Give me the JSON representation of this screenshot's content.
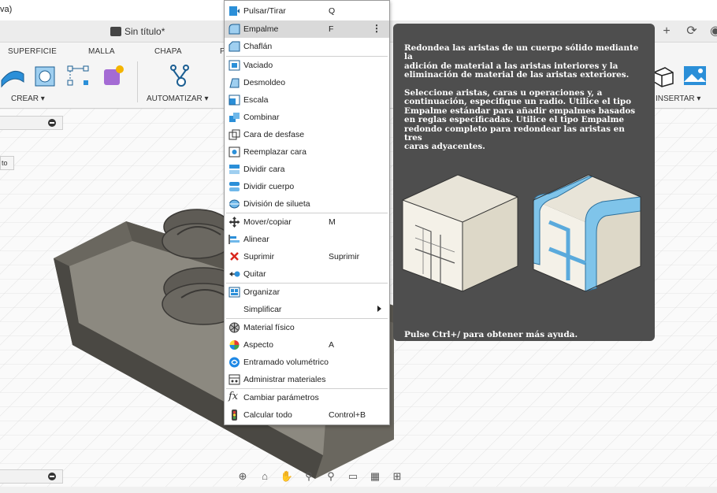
{
  "window": {
    "title": "va)"
  },
  "document": {
    "title": "Sin título*"
  },
  "ribbon": {
    "tabs": [
      "SUPERFICIE",
      "MALLA",
      "CHAPA",
      "P"
    ],
    "groups": {
      "create": "CREAR ▾",
      "automate": "AUTOMATIZAR ▾",
      "insert": "INSERTAR ▾"
    }
  },
  "browser": {
    "partial_label": "to"
  },
  "menu": {
    "items": [
      {
        "label": "Pulsar/Tirar",
        "shortcut": "Q",
        "icon": "push-pull-icon"
      },
      {
        "label": "Empalme",
        "shortcut": "F",
        "icon": "fillet-icon",
        "active": true
      },
      {
        "label": "Chaflán",
        "shortcut": "",
        "icon": "chamfer-icon"
      },
      {
        "label": "Vaciado",
        "shortcut": "",
        "icon": "shell-icon"
      },
      {
        "label": "Desmoldeo",
        "shortcut": "",
        "icon": "draft-icon"
      },
      {
        "label": "Escala",
        "shortcut": "",
        "icon": "scale-icon"
      },
      {
        "label": "Combinar",
        "shortcut": "",
        "icon": "combine-icon"
      },
      {
        "label": "Cara de desfase",
        "shortcut": "",
        "icon": "offset-face-icon"
      },
      {
        "label": "Reemplazar cara",
        "shortcut": "",
        "icon": "replace-face-icon"
      },
      {
        "label": "Dividir cara",
        "shortcut": "",
        "icon": "split-face-icon"
      },
      {
        "label": "Dividir cuerpo",
        "shortcut": "",
        "icon": "split-body-icon"
      },
      {
        "label": "División de silueta",
        "shortcut": "",
        "icon": "silhouette-split-icon"
      },
      {
        "label": "Mover/copiar",
        "shortcut": "M",
        "icon": "move-copy-icon"
      },
      {
        "label": "Alinear",
        "shortcut": "",
        "icon": "align-icon"
      },
      {
        "label": "Suprimir",
        "shortcut": "Suprimir",
        "icon": "delete-icon"
      },
      {
        "label": "Quitar",
        "shortcut": "",
        "icon": "remove-icon"
      },
      {
        "label": "Organizar",
        "shortcut": "",
        "icon": "arrange-icon"
      },
      {
        "label": "Simplificar",
        "shortcut": "",
        "icon": "simplify-icon",
        "submenu": true
      },
      {
        "label": "Material físico",
        "shortcut": "",
        "icon": "physical-material-icon"
      },
      {
        "label": "Aspecto",
        "shortcut": "A",
        "icon": "appearance-icon"
      },
      {
        "label": "Entramado volumétrico",
        "shortcut": "",
        "icon": "volumetric-lattice-icon"
      },
      {
        "label": "Administrar materiales",
        "shortcut": "",
        "icon": "manage-materials-icon"
      },
      {
        "label": "Cambiar parámetros",
        "shortcut": "",
        "icon": "parameters-icon"
      },
      {
        "label": "Calcular todo",
        "shortcut": "Control+B",
        "icon": "compute-all-icon"
      }
    ]
  },
  "tooltip": {
    "text": "Redondea las aristas de un cuerpo sólido mediante la\nadición de material a las aristas interiores y la\neliminación de material de las aristas exteriores.\n\nSeleccione aristas, caras u operaciones y, a\ncontinuación, especifique un radio. Utilice el tipo\nEmpalme estándar para añadir empalmes basados\nen reglas especificadas. Utilice el tipo Empalme\nredondo completo para redondear las aristas en tres\ncaras adyacentes.",
    "footer": "Pulse Ctrl+/ para obtener más ayuda."
  },
  "colors": {
    "accent": "#0696d7",
    "tooltip_bg": "#4e4e4e",
    "fillet_blue": "#7fc4ea"
  }
}
